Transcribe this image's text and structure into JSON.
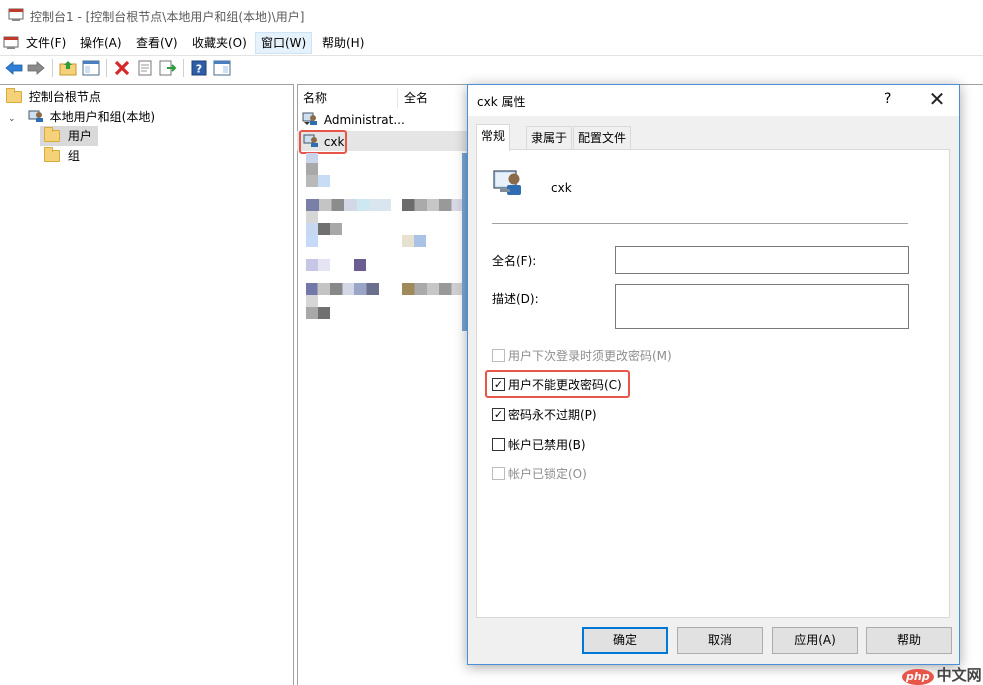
{
  "window": {
    "title": "控制台1 - [控制台根节点\\本地用户和组(本地)\\用户]"
  },
  "menu": {
    "items": [
      {
        "label": "文件(F)"
      },
      {
        "label": "操作(A)"
      },
      {
        "label": "查看(V)"
      },
      {
        "label": "收藏夹(O)"
      },
      {
        "label": "窗口(W)"
      },
      {
        "label": "帮助(H)"
      }
    ]
  },
  "toolbar": {
    "icons": [
      "back-arrow-icon",
      "forward-arrow-icon",
      "up-folder-icon",
      "show-hide-tree-icon",
      "delete-icon",
      "properties-icon",
      "export-list-icon",
      "help-icon",
      "show-hide-action-pane-icon"
    ]
  },
  "tree": {
    "root": "控制台根节点",
    "local_users_groups": "本地用户和组(本地)",
    "users": "用户",
    "groups": "组"
  },
  "list": {
    "columns": [
      "名称",
      "全名"
    ],
    "rows": [
      {
        "name": "Administrat..."
      },
      {
        "name": "cxk"
      }
    ]
  },
  "dialog": {
    "title": "cxk 属性",
    "help_symbol": "?",
    "close_symbol": "✕",
    "tabs": [
      "常规",
      "隶属于",
      "配置文件"
    ],
    "username": "cxk",
    "fullname_label": "全名(F):",
    "fullname_value": "",
    "description_label": "描述(D):",
    "description_value": "",
    "checkboxes": [
      {
        "label": "用户下次登录时须更改密码(M)",
        "checked": false,
        "enabled": false
      },
      {
        "label": "用户不能更改密码(C)",
        "checked": true,
        "enabled": true
      },
      {
        "label": "密码永不过期(P)",
        "checked": true,
        "enabled": true
      },
      {
        "label": "帐户已禁用(B)",
        "checked": false,
        "enabled": true
      },
      {
        "label": "帐户已锁定(O)",
        "checked": false,
        "enabled": false
      }
    ],
    "buttons": {
      "ok": "确定",
      "cancel": "取消",
      "apply": "应用(A)",
      "help": "帮助"
    },
    "check_mark": "✓"
  },
  "watermark": {
    "badge": "php",
    "text": "中文网"
  },
  "colors": {
    "accent": "#0078d7",
    "highlight_red": "#e8564a",
    "folder": "#f5d27a"
  }
}
